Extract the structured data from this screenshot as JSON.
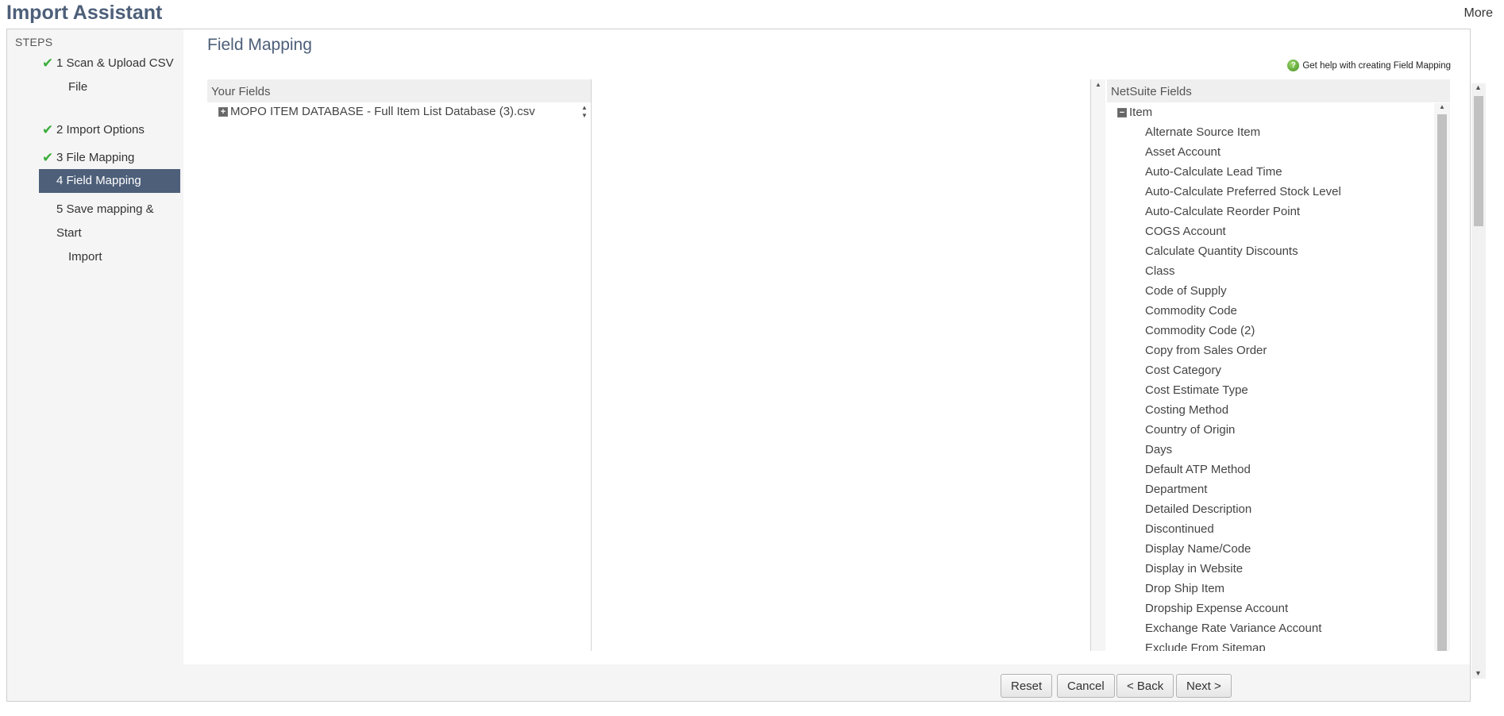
{
  "header": {
    "title": "Import Assistant",
    "more_label": "More"
  },
  "steps": {
    "label": "STEPS",
    "items": [
      {
        "line1": "1  Scan & Upload CSV",
        "line2": "File",
        "done": true
      },
      {
        "line1": "2  Import Options",
        "done": true
      },
      {
        "line1": "3  File Mapping",
        "done": true
      },
      {
        "line1": "4  Field Mapping",
        "active": true
      },
      {
        "line1": "5  Save mapping & Start",
        "line2": "Import"
      }
    ]
  },
  "main": {
    "title": "Field Mapping",
    "help_link": "Get help with creating Field Mapping",
    "your_fields": {
      "header": "Your Fields",
      "file": "MOPO ITEM DATABASE - Full Item List Database (3).csv"
    },
    "netsuite_fields": {
      "header": "NetSuite Fields",
      "root": "Item",
      "items": [
        "Alternate Source Item",
        "Asset Account",
        "Auto-Calculate Lead Time",
        "Auto-Calculate Preferred Stock Level",
        "Auto-Calculate Reorder Point",
        "COGS Account",
        "Calculate Quantity Discounts",
        "Class",
        "Code of Supply",
        "Commodity Code",
        "Commodity Code (2)",
        "Copy from Sales Order",
        "Cost Category",
        "Cost Estimate Type",
        "Costing Method",
        "Country of Origin",
        "Days",
        "Default ATP Method",
        "Department",
        "Detailed Description",
        "Discontinued",
        "Display Name/Code",
        "Display in Website",
        "Drop Ship Item",
        "Dropship Expense Account",
        "Exchange Rate Variance Account",
        "Exclude From Sitemap"
      ]
    }
  },
  "footer": {
    "reset_label": "Reset",
    "cancel_label": "Cancel",
    "back_label": "< Back",
    "next_label": "Next >"
  }
}
